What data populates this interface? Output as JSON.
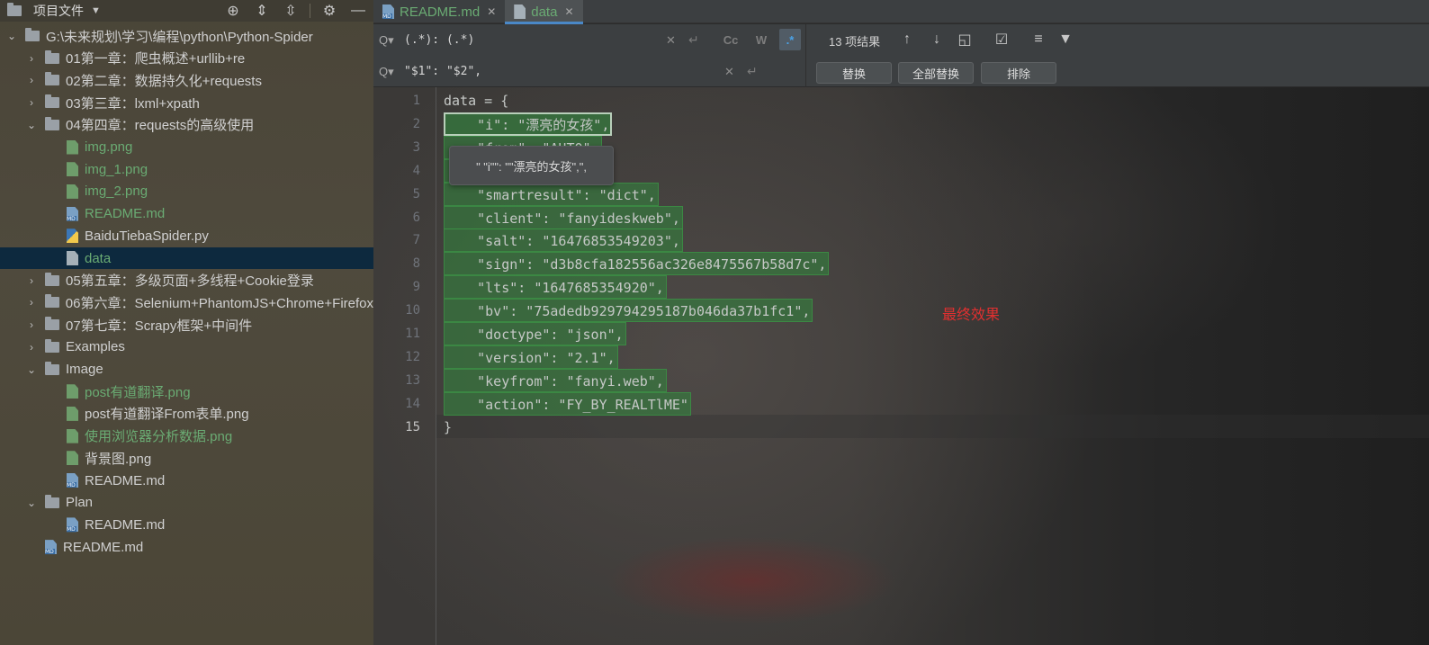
{
  "project": {
    "title": "项目文件",
    "tree": [
      {
        "label": "G:\\未来规划\\学习\\编程\\python\\Python-Spider",
        "kind": "folder",
        "depth": 0,
        "expanded": true,
        "color": "normal"
      },
      {
        "label": "01第一章：爬虫概述+urllib+re",
        "kind": "folder",
        "depth": 1,
        "expanded": false,
        "color": "normal"
      },
      {
        "label": "02第二章：数据持久化+requests",
        "kind": "folder",
        "depth": 1,
        "expanded": false,
        "color": "normal"
      },
      {
        "label": "03第三章：lxml+xpath",
        "kind": "folder",
        "depth": 1,
        "expanded": false,
        "color": "normal"
      },
      {
        "label": "04第四章：requests的高级使用",
        "kind": "folder",
        "depth": 1,
        "expanded": true,
        "color": "normal"
      },
      {
        "label": "img.png",
        "kind": "img",
        "depth": 2,
        "color": "green"
      },
      {
        "label": "img_1.png",
        "kind": "img",
        "depth": 2,
        "color": "green"
      },
      {
        "label": "img_2.png",
        "kind": "img",
        "depth": 2,
        "color": "green"
      },
      {
        "label": "README.md",
        "kind": "md",
        "depth": 2,
        "color": "green"
      },
      {
        "label": "BaiduTiebaSpider.py",
        "kind": "py",
        "depth": 2,
        "color": "normal"
      },
      {
        "label": "data",
        "kind": "txt",
        "depth": 2,
        "color": "green",
        "selected": true
      },
      {
        "label": "05第五章：多级页面+多线程+Cookie登录",
        "kind": "folder",
        "depth": 1,
        "expanded": false,
        "color": "normal"
      },
      {
        "label": "06第六章：Selenium+PhantomJS+Chrome+Firefox",
        "kind": "folder",
        "depth": 1,
        "expanded": false,
        "color": "normal"
      },
      {
        "label": "07第七章：Scrapy框架+中间件",
        "kind": "folder",
        "depth": 1,
        "expanded": false,
        "color": "normal"
      },
      {
        "label": "Examples",
        "kind": "folder",
        "depth": 1,
        "expanded": false,
        "color": "normal"
      },
      {
        "label": "Image",
        "kind": "folder",
        "depth": 1,
        "expanded": true,
        "color": "normal"
      },
      {
        "label": "post有道翻译.png",
        "kind": "img",
        "depth": 2,
        "color": "green"
      },
      {
        "label": "post有道翻译From表单.png",
        "kind": "img",
        "depth": 2,
        "color": "normal"
      },
      {
        "label": "使用浏览器分析数据.png",
        "kind": "img",
        "depth": 2,
        "color": "green"
      },
      {
        "label": "背景图.png",
        "kind": "img",
        "depth": 2,
        "color": "normal"
      },
      {
        "label": "README.md",
        "kind": "md",
        "depth": 2,
        "color": "normal"
      },
      {
        "label": "Plan",
        "kind": "folder",
        "depth": 1,
        "expanded": true,
        "color": "normal"
      },
      {
        "label": "README.md",
        "kind": "md",
        "depth": 2,
        "color": "normal"
      },
      {
        "label": "README.md",
        "kind": "md",
        "depth": 1,
        "color": "normal"
      }
    ]
  },
  "tabs": [
    {
      "label": "README.md",
      "kind": "md",
      "active": false
    },
    {
      "label": "data",
      "kind": "txt",
      "active": true
    }
  ],
  "find": {
    "search_text": "(.*): (.*)",
    "replace_text": "\"$1\": \"$2\",",
    "match_case_label": "Cc",
    "word_label": "W",
    "regex_label": ".*",
    "results": "13 项结果",
    "replace_label": "替换",
    "replace_all_label": "全部替换",
    "exclude_label": "排除"
  },
  "editor": {
    "current_line": 15,
    "lines": [
      "data = {",
      "    \"i\": \"漂亮的女孩\",",
      "    \"from\": \"AUTO\",",
      "    \"to\": \"AUTO\",",
      "    \"smartresult\": \"dict\",",
      "    \"client\": \"fanyideskweb\",",
      "    \"salt\": \"16476853549203\",",
      "    \"sign\": \"d3b8cfa182556ac326e8475567b58d7c\",",
      "    \"lts\": \"1647685354920\",",
      "    \"bv\": \"75adedb929794295187b046da37b1fc1\",",
      "    \"doctype\": \"json\",",
      "    \"version\": \"2.1\",",
      "    \"keyfrom\": \"fanyi.web\",",
      "    \"action\": \"FY_BY_REALTlME\"",
      "}"
    ],
    "tooltip": "\" \"i\"\": \"\"漂亮的女孩\",\",",
    "note": "最终效果"
  }
}
